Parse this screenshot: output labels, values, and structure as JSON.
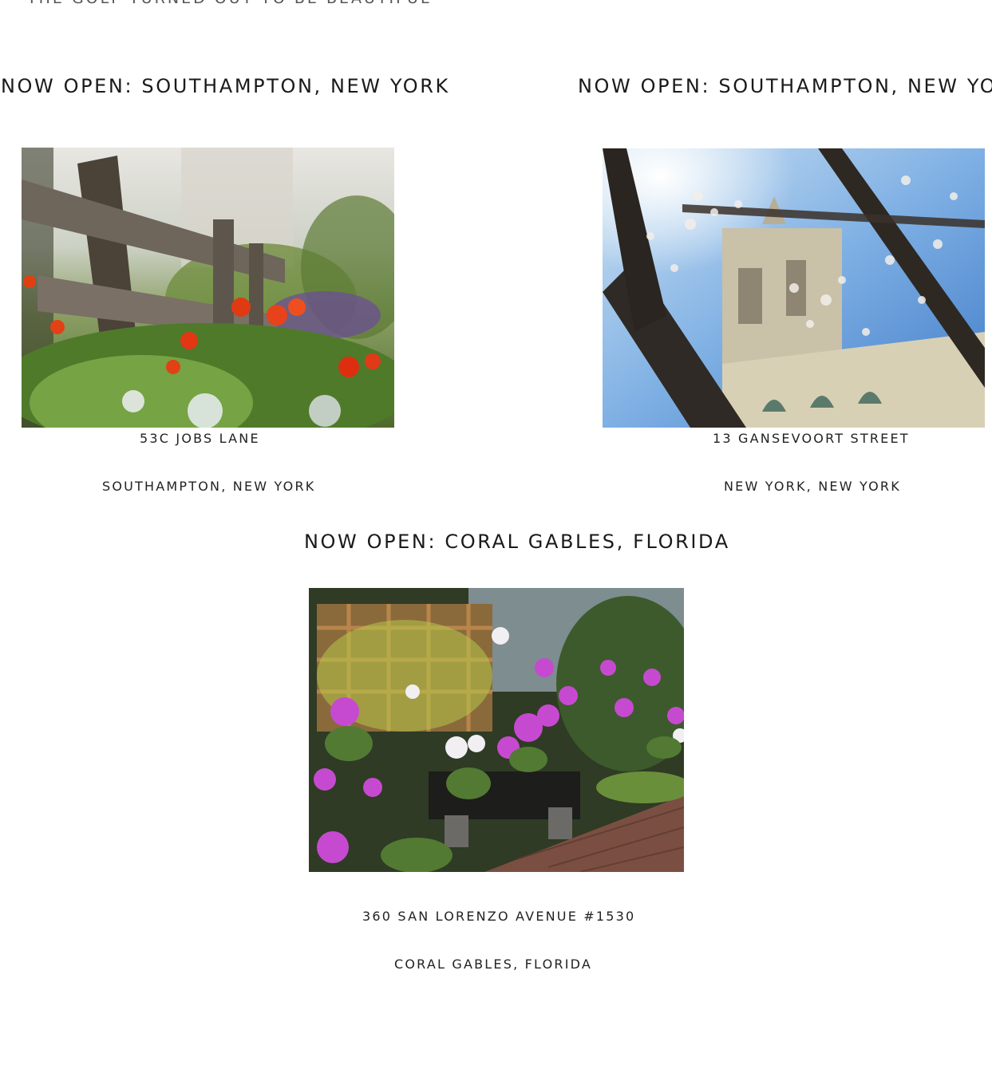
{
  "header": {
    "partial_tagline": "THE GOLF TURNED OUT TO BE BEAUTIFUL"
  },
  "locations": [
    {
      "heading": "NOW OPEN: SOUTHAMPTON, NEW YORK",
      "address_line1": "53C JOBS LANE",
      "address_line2": "SOUTHAMPTON, NEW YORK",
      "photo": "poppies-by-fence-photo"
    },
    {
      "heading": "NOW OPEN: SOUTHAMPTON, NEW YORK",
      "address_line1": "13 GANSEVOORT STREET",
      "address_line2": "NEW YORK, NEW YORK",
      "photo": "cherry-blossom-church-photo"
    },
    {
      "heading": "NOW OPEN: CORAL GABLES, FLORIDA",
      "address_line1": "360 SAN LORENZO AVENUE #1530",
      "address_line2": "CORAL GABLES, FLORIDA",
      "photo": "orchid-garden-photo"
    }
  ]
}
